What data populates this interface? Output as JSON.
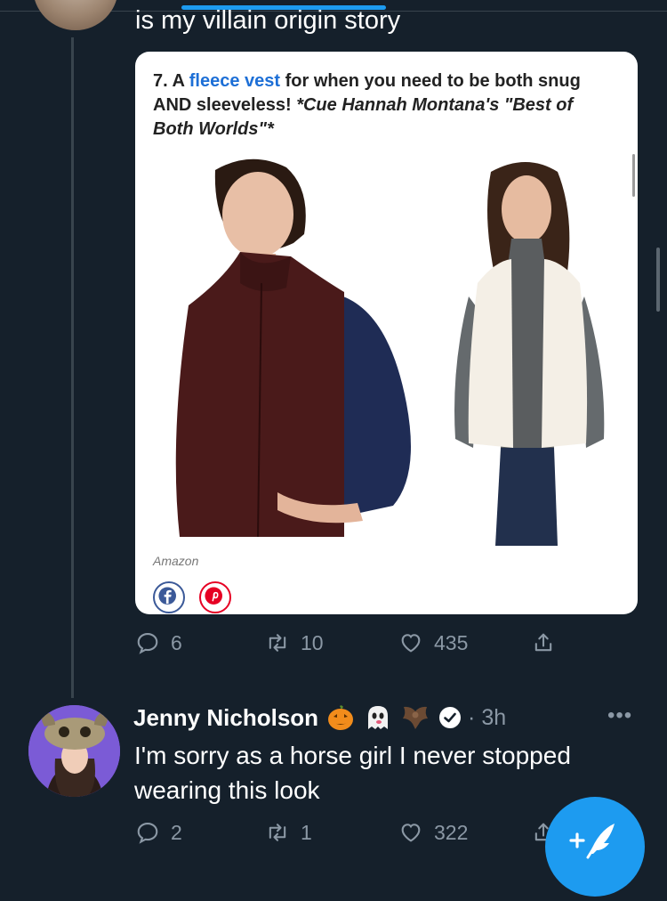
{
  "previous_tweet": {
    "text": "is my villain origin story",
    "card": {
      "caption_prefix": "7. A ",
      "caption_link": "fleece vest",
      "caption_middle": " for when you need to be both snug AND sleeveless! ",
      "caption_italic": "*Cue Hannah Montana's \"Best of Both Worlds\"*",
      "source": "Amazon",
      "share_icons": [
        "facebook-icon",
        "pinterest-icon"
      ]
    },
    "actions": {
      "replies": "6",
      "retweets": "10",
      "likes": "435"
    }
  },
  "reply_tweet": {
    "author_name": "Jenny Nicholson",
    "emojis": [
      "jack-o-lantern-icon",
      "ghost-icon",
      "bat-icon"
    ],
    "verified": true,
    "time": "· 3h",
    "more": "•••",
    "text": "I'm sorry as a horse girl I never stopped wearing this look",
    "actions": {
      "replies": "2",
      "retweets": "1",
      "likes": "322"
    }
  },
  "fab": {
    "icon": "compose-tweet-icon",
    "label": "+"
  },
  "colors": {
    "background": "#15202b",
    "accent": "#1d9bf0",
    "muted": "#8b98a5"
  }
}
